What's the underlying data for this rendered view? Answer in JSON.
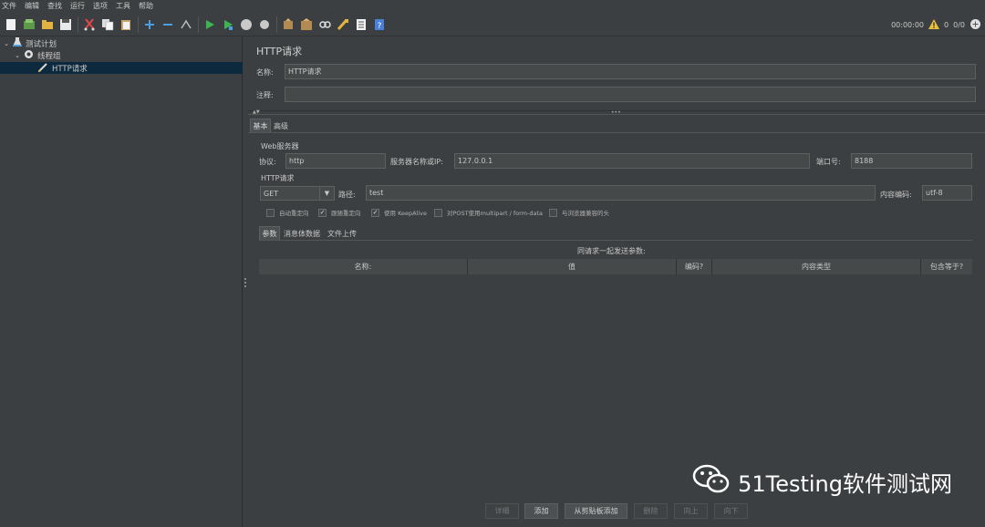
{
  "menu": [
    "文件",
    "编辑",
    "查找",
    "运行",
    "选项",
    "工具",
    "帮助"
  ],
  "toolbar_status": {
    "time": "00:00:00",
    "warnings": "0",
    "threads": "0/0"
  },
  "tree": [
    {
      "label": "测试计划"
    },
    {
      "label": "线程组"
    },
    {
      "label": "HTTP请求"
    }
  ],
  "panel": {
    "title": "HTTP请求",
    "name_label": "名称:",
    "name_value": "HTTP请求",
    "comment_label": "注释:",
    "comment_value": "",
    "tabs": [
      "基本",
      "高级"
    ],
    "web_server_label": "Web服务器",
    "protocol_label": "协议:",
    "protocol_value": "http",
    "server_label": "服务器名称或IP:",
    "server_value": "127.0.0.1",
    "port_label": "端口号:",
    "port_value": "8188",
    "http_request_label": "HTTP请求",
    "method_value": "GET",
    "path_label": "路径:",
    "path_value": "test",
    "encoding_label": "内容编码:",
    "encoding_value": "utf-8",
    "checkboxes": [
      {
        "label": "自动重定向",
        "checked": false
      },
      {
        "label": "跟随重定向",
        "checked": true
      },
      {
        "label": "使用 KeepAlive",
        "checked": true
      },
      {
        "label": "对POST使用multipart / form-data",
        "checked": false
      },
      {
        "label": "与浏览器兼容的头",
        "checked": false
      }
    ],
    "subtabs": [
      "参数",
      "消息体数据",
      "文件上传"
    ],
    "params_caption": "同请求一起发送参数:",
    "columns": [
      "名称:",
      "值",
      "编码?",
      "内容类型",
      "包含等于?"
    ],
    "buttons": [
      "详细",
      "添加",
      "从剪贴板添加",
      "删除",
      "向上",
      "向下"
    ]
  },
  "watermark": "51Testing软件测试网"
}
